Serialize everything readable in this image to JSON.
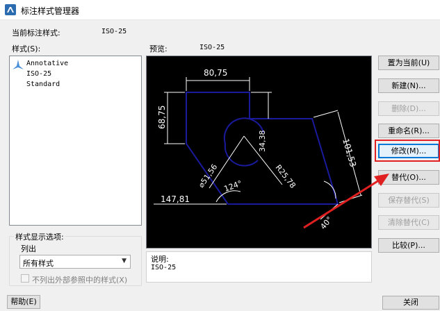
{
  "window": {
    "title": "标注样式管理器",
    "icon": "autocad-icon"
  },
  "current_style": {
    "label": "当前标注样式:",
    "value": "ISO-25"
  },
  "styles_list": {
    "label": "样式(S):",
    "items": [
      "Annotative",
      "ISO-25",
      "Standard"
    ]
  },
  "preview": {
    "label": "预览:",
    "value": "ISO-25",
    "dims": {
      "width_top": "80,75",
      "height_left": "68,75",
      "small_vertical": "34,38",
      "slanted_right": "101,53",
      "diameter": "⌀51,56",
      "radius": "R25,78",
      "angle_top": "124°",
      "base_left": "147,81",
      "angle_bottom": "40°"
    }
  },
  "description": {
    "label": "说明:",
    "value": "ISO-25"
  },
  "display_options": {
    "group_label": "样式显示选项:",
    "list_label": "列出",
    "selected": "所有样式",
    "checkbox_label": "不列出外部参照中的样式(X)",
    "checkbox_checked": false
  },
  "buttons": {
    "set_current": "置为当前(U)",
    "new": "新建(N)...",
    "delete": "删除(D)...",
    "rename": "重命名(R)...",
    "modify": "修改(M)...",
    "override": "替代(O)...",
    "save_override": "保存替代(S)",
    "clear_override": "清除替代(C)",
    "compare": "比较(P)...",
    "help": "帮助(E)",
    "close": "关闭"
  },
  "colors": {
    "preview_bg": "#000000",
    "geometry": "#1a1a9c",
    "dimension": "#ffffff",
    "annotation": "#e02020",
    "focus": "#0078d7"
  }
}
